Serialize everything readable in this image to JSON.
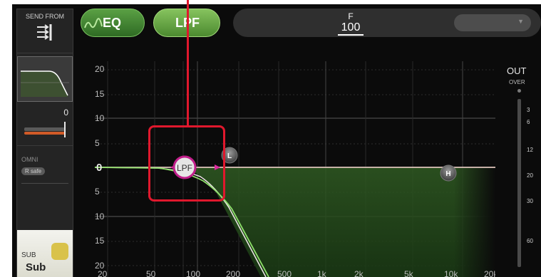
{
  "sidebar": {
    "send_from_label": "SEND FROM",
    "gain_value": "0",
    "omni_label": "OMNI",
    "rsafe_label": "R safe",
    "sub_small": "SUB",
    "sub_name": "Sub"
  },
  "toolbar": {
    "eq_label": "EQ",
    "lpf_label": "LPF"
  },
  "freq": {
    "label": "F",
    "value": "100",
    "dropdown_arrow": "▼"
  },
  "graph": {
    "y_ticks": [
      "20",
      "15",
      "10",
      "5",
      "0",
      "5",
      "10",
      "15",
      "20"
    ],
    "x_ticks": [
      "20",
      "50",
      "100",
      "200",
      "500",
      "1k",
      "2k",
      "5k",
      "10k",
      "20k"
    ],
    "lpf_handle_label": "LPF",
    "low_handle_label": "L",
    "high_handle_label": "H"
  },
  "meter": {
    "out_label": "OUT",
    "over_label": "OVER",
    "ticks": [
      "3",
      "6",
      "12",
      "20",
      "30",
      "60"
    ]
  },
  "colors": {
    "eq_green": "#5aa044",
    "lpf_green": "#86c35e",
    "curve_white": "#e8e4e0",
    "curve_green": "#8ee06a",
    "handle_pink": "#c01e8a",
    "callout_red": "#e0182d",
    "gain_orange": "#d15a27"
  }
}
